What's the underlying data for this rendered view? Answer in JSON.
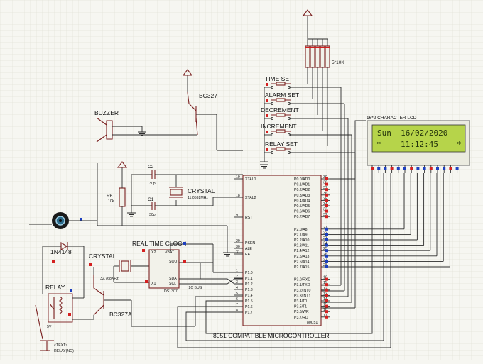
{
  "components": {
    "resistor_pack": {
      "label": "5*10K"
    },
    "buttons": [
      {
        "label": "TIME SET"
      },
      {
        "label": "ALARM SET"
      },
      {
        "label": "DECREMENT"
      },
      {
        "label": "INCREMENT"
      },
      {
        "label": "RELAY SET"
      }
    ],
    "lcd": {
      "title": "16*2 CHARACTER LCD",
      "line1": "Sun  16/02/2020",
      "line2": "11:12:45",
      "line2_mark_left": "*",
      "line2_mark_right": "*"
    },
    "buzzer": {
      "label": "BUZZER"
    },
    "transistor_top": {
      "label": "BC327"
    },
    "transistor_bottom": {
      "label": "BC327A"
    },
    "c2": {
      "label": "C2",
      "value": "30p"
    },
    "c1": {
      "label": "C1",
      "value": "30p"
    },
    "crystal_main": {
      "label": "CRYSTAL",
      "value": "11.0592MHz"
    },
    "r6": {
      "label": "R6",
      "value": "10k"
    },
    "diode": {
      "label": "1N4148"
    },
    "crystal_rtc": {
      "label": "CRYSTAL",
      "value": "32.768KHz"
    },
    "rtc": {
      "title": "REAL TIME CLOCK",
      "chip": "DS1307",
      "pins": [
        "X2",
        "VBAT",
        "SOUT",
        "SDA",
        "SCL",
        "X1"
      ]
    },
    "relay": {
      "label": "RELAY",
      "voltage": "5V"
    },
    "terminal": {
      "label": "<TEXT>",
      "sub": "RELAY(NO)"
    },
    "i2c_bus": {
      "label": "I2C BUS"
    },
    "mcu": {
      "title": "8051 COMPATIBLE MICROCONTROLLER",
      "chip": "80C51",
      "left_pins": [
        "XTAL1",
        "XTAL2",
        "RST",
        "PSEN",
        "ALE",
        "EA",
        "P1.0",
        "P1.1",
        "P1.2",
        "P1.3",
        "P1.4",
        "P1.5",
        "P1.6",
        "P1.7"
      ],
      "right_pins": [
        "P0.0/AD0",
        "P0.1/AD1",
        "P0.2/AD2",
        "P0.3/AD3",
        "P0.4/AD4",
        "P0.5/AD5",
        "P0.6/AD6",
        "P0.7/AD7",
        "P2.0/A8",
        "P2.1/A9",
        "P2.2/A10",
        "P2.3/A11",
        "P2.4/A12",
        "P2.5/A13",
        "P2.6/A14",
        "P2.7/A15",
        "P3.0/RXD",
        "P3.1/TXD",
        "P3.2/INT0",
        "P3.3/INT1",
        "P3.4/T0",
        "P3.5/T1",
        "P3.6/WR",
        "P3.7/RD"
      ],
      "left_pin_numbers": [
        "19",
        "18",
        "9",
        "29",
        "30",
        "31",
        "1",
        "2",
        "3",
        "4",
        "5",
        "6",
        "7",
        "8"
      ],
      "right_pin_numbers": [
        "39",
        "38",
        "37",
        "36",
        "35",
        "34",
        "33",
        "32",
        "21",
        "22",
        "23",
        "24",
        "25",
        "26",
        "27",
        "28",
        "10",
        "11",
        "12",
        "13",
        "14",
        "15",
        "16",
        "17"
      ]
    }
  },
  "colors": {
    "background": "#f6f6f1",
    "grid": "#d9d9cf",
    "wire": "#2c2c2c",
    "component": "#7a1f1f",
    "lcd_screen": "#b6d44a",
    "lcd_text": "#23330b",
    "pin_blue": "#1d3fbf",
    "pin_red": "#d42020"
  }
}
